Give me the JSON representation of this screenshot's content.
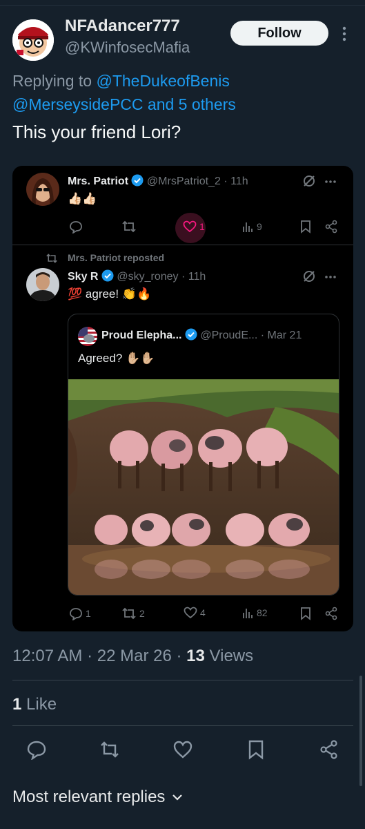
{
  "tweet": {
    "author_name": "NFAdancer777",
    "author_handle": "@KWinfosecMafia",
    "follow_label": "Follow",
    "replying_prefix": "Replying to",
    "replying_mention_1": "@TheDukeofBenis",
    "replying_mention_2": "@MerseysidePCC",
    "replying_others": "and 5 others",
    "text": "This your friend Lori?",
    "time": "12:07 AM",
    "dot1": "·",
    "date": "22 Mar 26",
    "dot2": "·",
    "views_count": "13",
    "views_label": "Views",
    "likes_count": "1",
    "likes_label": "Like",
    "replies_sort_label": "Most relevant replies"
  },
  "embed": {
    "post1": {
      "name": "Mrs. Patriot",
      "handle_time": "@MrsPatriot_2 · 11h",
      "text": "👍🏻👍🏻",
      "likes": "1",
      "views": "9"
    },
    "repost_label": "Mrs. Patriot reposted",
    "post2": {
      "name": "Sky R",
      "handle_time": "@sky_roney · 11h",
      "text_emoji": "💯",
      "text": "agree!",
      "text_end_emoji": "👏🔥",
      "replies": "1",
      "reposts": "2",
      "likes": "4",
      "views": "82"
    },
    "quote": {
      "name": "Proud Elepha...",
      "handle": "@ProudE...",
      "date": "· Mar 21",
      "text": "Agreed?",
      "text_emoji": "✋🏼✋🏼"
    }
  },
  "colors": {
    "background": "#15202b",
    "accent": "#1d9bf0",
    "muted": "#8b98a5",
    "like_pink": "#f91880"
  }
}
